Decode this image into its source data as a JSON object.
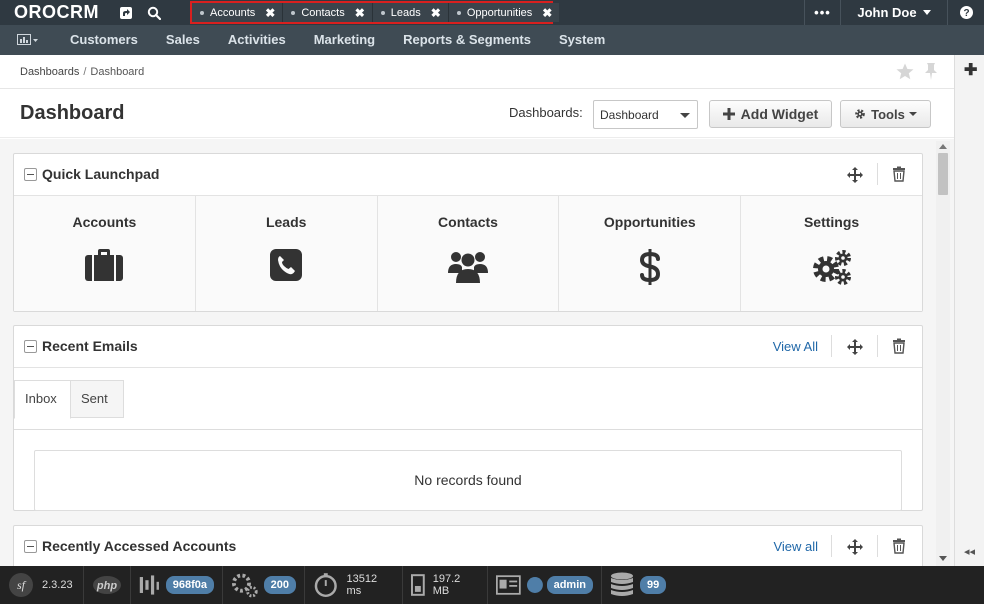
{
  "app": {
    "logo": "OROCRM",
    "pins": [
      "Accounts",
      "Contacts",
      "Leads",
      "Opportunities"
    ],
    "more_label": "•••",
    "user_name": "John Doe",
    "help_label": "?"
  },
  "nav": {
    "items": [
      "Customers",
      "Sales",
      "Activities",
      "Marketing",
      "Reports & Segments",
      "System"
    ]
  },
  "breadcrumb": {
    "root": "Dashboards",
    "separator": "/",
    "current": "Dashboard"
  },
  "header": {
    "title": "Dashboard",
    "dashboards_label": "Dashboards:",
    "dashboard_select_value": "Dashboard",
    "add_widget_label": "Add Widget",
    "tools_label": "Tools"
  },
  "widgets": {
    "quick_launchpad": {
      "title": "Quick Launchpad",
      "items": [
        {
          "label": "Accounts",
          "icon": "briefcase-icon"
        },
        {
          "label": "Leads",
          "icon": "phone-icon"
        },
        {
          "label": "Contacts",
          "icon": "users-icon"
        },
        {
          "label": "Opportunities",
          "icon": "dollar-icon"
        },
        {
          "label": "Settings",
          "icon": "gears-icon"
        }
      ]
    },
    "recent_emails": {
      "title": "Recent Emails",
      "view_all_label": "View All",
      "tabs": [
        "Inbox",
        "Sent"
      ],
      "active_tab": "Inbox",
      "empty_message": "No records found"
    },
    "recent_accounts": {
      "title": "Recently Accessed Accounts",
      "view_all_label": "View all"
    }
  },
  "debug_toolbar": {
    "symfony_version": "2.3.23",
    "php_label": "php",
    "token": "968f0a",
    "status_code": "200",
    "time": "13512 ms",
    "memory": "197.2 MB",
    "user": "admin",
    "db_queries": "99"
  },
  "colors": {
    "topbar": "#2f3941",
    "nav": "#3f4b54",
    "pin_highlight": "#d9201f",
    "link": "#1f67a8",
    "badge": "#4f7ea8"
  }
}
